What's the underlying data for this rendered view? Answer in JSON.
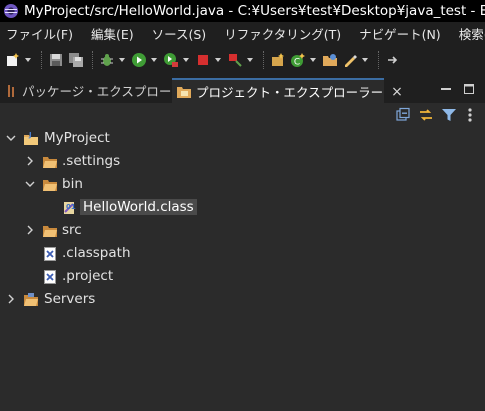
{
  "window": {
    "title": "MyProject/src/HelloWorld.java - C:¥Users¥test¥Desktop¥java_test - Eclipse IDE"
  },
  "menubar": {
    "items": [
      "ファイル(F)",
      "編集(E)",
      "ソース(S)",
      "リファクタリング(T)",
      "ナビゲート(N)",
      "検索(A)"
    ]
  },
  "tabs": {
    "package_explorer": "パッケージ・エクスプローラー",
    "project_explorer": "プロジェクト・エクスプローラー",
    "close_glyph": "×"
  },
  "tree": {
    "project": "MyProject",
    "settings": ".settings",
    "bin": "bin",
    "class_file": "HelloWorld.class",
    "src": "src",
    "classpath": ".classpath",
    "project_file": ".project",
    "servers": "Servers"
  },
  "colors": {
    "folder": "#e0a95a",
    "accent": "#3b6da3",
    "selection": "#4a4a4a"
  },
  "icons": {
    "folder": "folder-icon",
    "project": "java-project-icon",
    "xml": "xml-file-icon",
    "class": "class-file-icon"
  }
}
